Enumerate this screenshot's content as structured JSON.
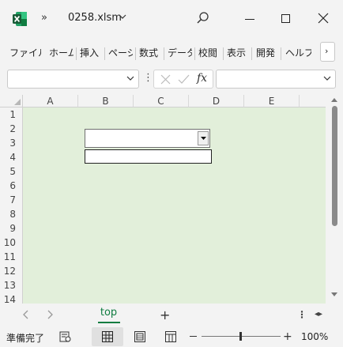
{
  "app": {
    "name": "Excel",
    "brand_color": "#107c41"
  },
  "titlebar": {
    "file_name": "0258.xlsm",
    "more_glyph": "»",
    "icons": [
      "excel-logo-icon",
      "chevron-down-icon",
      "search-icon",
      "minimize-icon",
      "maximize-icon",
      "close-icon"
    ]
  },
  "ribbon": {
    "tabs": [
      "ファイル",
      "ホーム",
      "挿入",
      "ページ",
      "数式",
      "データ",
      "校閲",
      "表示",
      "開発",
      "ヘルプ"
    ],
    "more_glyph": "›"
  },
  "formula_bar": {
    "name_box_value": "",
    "fx_label": "fx",
    "formula_value": ""
  },
  "grid": {
    "columns": [
      "A",
      "B",
      "C",
      "D",
      "E"
    ],
    "rows": [
      "1",
      "2",
      "3",
      "4",
      "5",
      "6",
      "7",
      "8",
      "9",
      "10",
      "11",
      "12",
      "13",
      "14"
    ],
    "background_color": "#e2efda"
  },
  "form_controls": {
    "combo_box_value": "",
    "text_box_value": ""
  },
  "sheets": {
    "tabs": [
      "top"
    ],
    "active": "top",
    "add_glyph": "+"
  },
  "statusbar": {
    "status_text": "準備完了",
    "zoom_minus": "−",
    "zoom_plus": "+",
    "zoom_level": "100%"
  }
}
